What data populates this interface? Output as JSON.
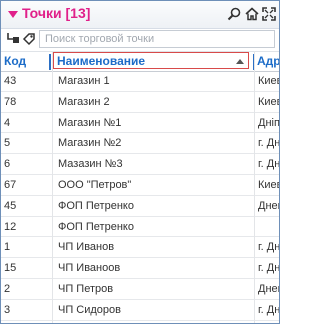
{
  "panel": {
    "title": "Точки [13]",
    "title_color": "#e0208a",
    "accent": "#1c6cc8",
    "icons": [
      "caret-down-icon",
      "search-icon",
      "home-icon",
      "expand-icon"
    ]
  },
  "toolbar": {
    "icons": [
      "filter-icon",
      "tag-icon"
    ],
    "search_placeholder": "Поиск торговой точки",
    "search_value": ""
  },
  "grid": {
    "columns": [
      "Код",
      "Наименование",
      "Адр"
    ],
    "sorted_column": "Наименование",
    "sort_direction": "ascending",
    "rows": [
      {
        "code": "43",
        "name": "Магазин 1",
        "addr": "Киев"
      },
      {
        "code": "78",
        "name": "Магазин 2",
        "addr": "Киев"
      },
      {
        "code": "4",
        "name": "Магазин №1",
        "addr": "Дніп"
      },
      {
        "code": "5",
        "name": "Магазин №2",
        "addr": "г. Дн"
      },
      {
        "code": "6",
        "name": "Мазазин №3",
        "addr": "г. Дн"
      },
      {
        "code": "67",
        "name": "ООО \"Петров\"",
        "addr": "Киев"
      },
      {
        "code": "45",
        "name": "ФОП Петренко",
        "addr": "Днеп"
      },
      {
        "code": "12",
        "name": "ФОП Петренко",
        "addr": ""
      },
      {
        "code": "1",
        "name": "ЧП Иванов",
        "addr": "г. Дн"
      },
      {
        "code": "15",
        "name": "ЧП Иваноов",
        "addr": "г. Дн"
      },
      {
        "code": "2",
        "name": "ЧП Петров",
        "addr": "Днеп"
      },
      {
        "code": "3",
        "name": "ЧП Сидоров",
        "addr": "г. Дн"
      }
    ]
  }
}
